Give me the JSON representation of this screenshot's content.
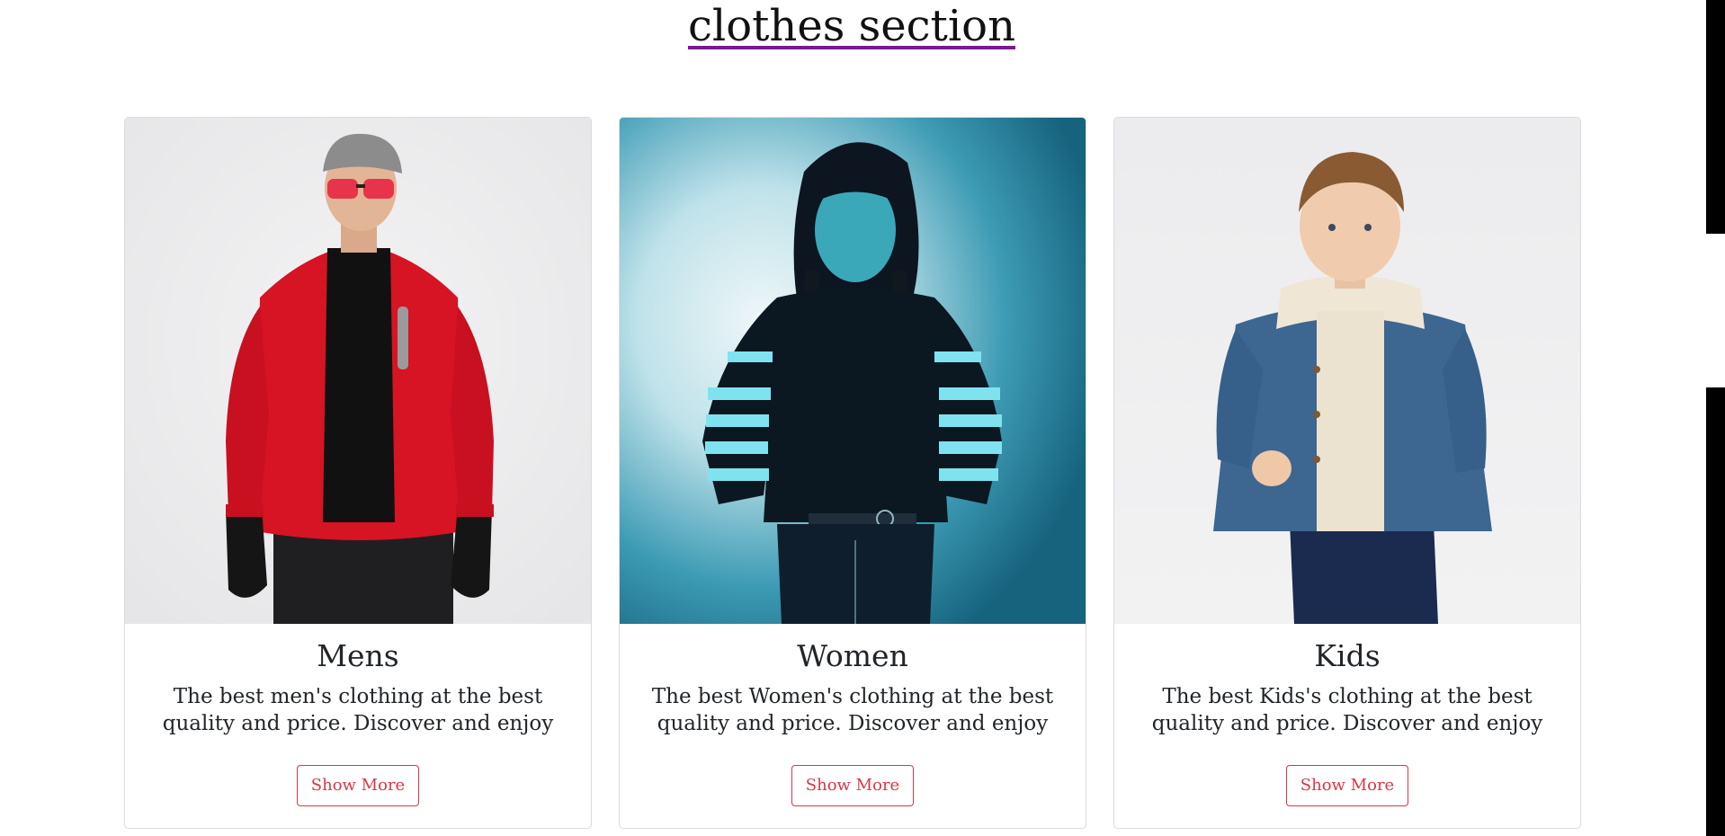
{
  "section": {
    "title": "clothes section"
  },
  "cards": [
    {
      "title": "Mens",
      "text": "The best men's clothing at the best quality and price. Discover and enjoy",
      "button": "Show More"
    },
    {
      "title": "Women",
      "text": "The best Women's clothing at the best quality and price. Discover and enjoy",
      "button": "Show More"
    },
    {
      "title": "Kids",
      "text": "The best Kids's clothing at the best quality and price. Discover and enjoy",
      "button": "Show More"
    }
  ],
  "colors": {
    "title_underline": "#7a1a8c",
    "button_accent": "#dc3545"
  }
}
